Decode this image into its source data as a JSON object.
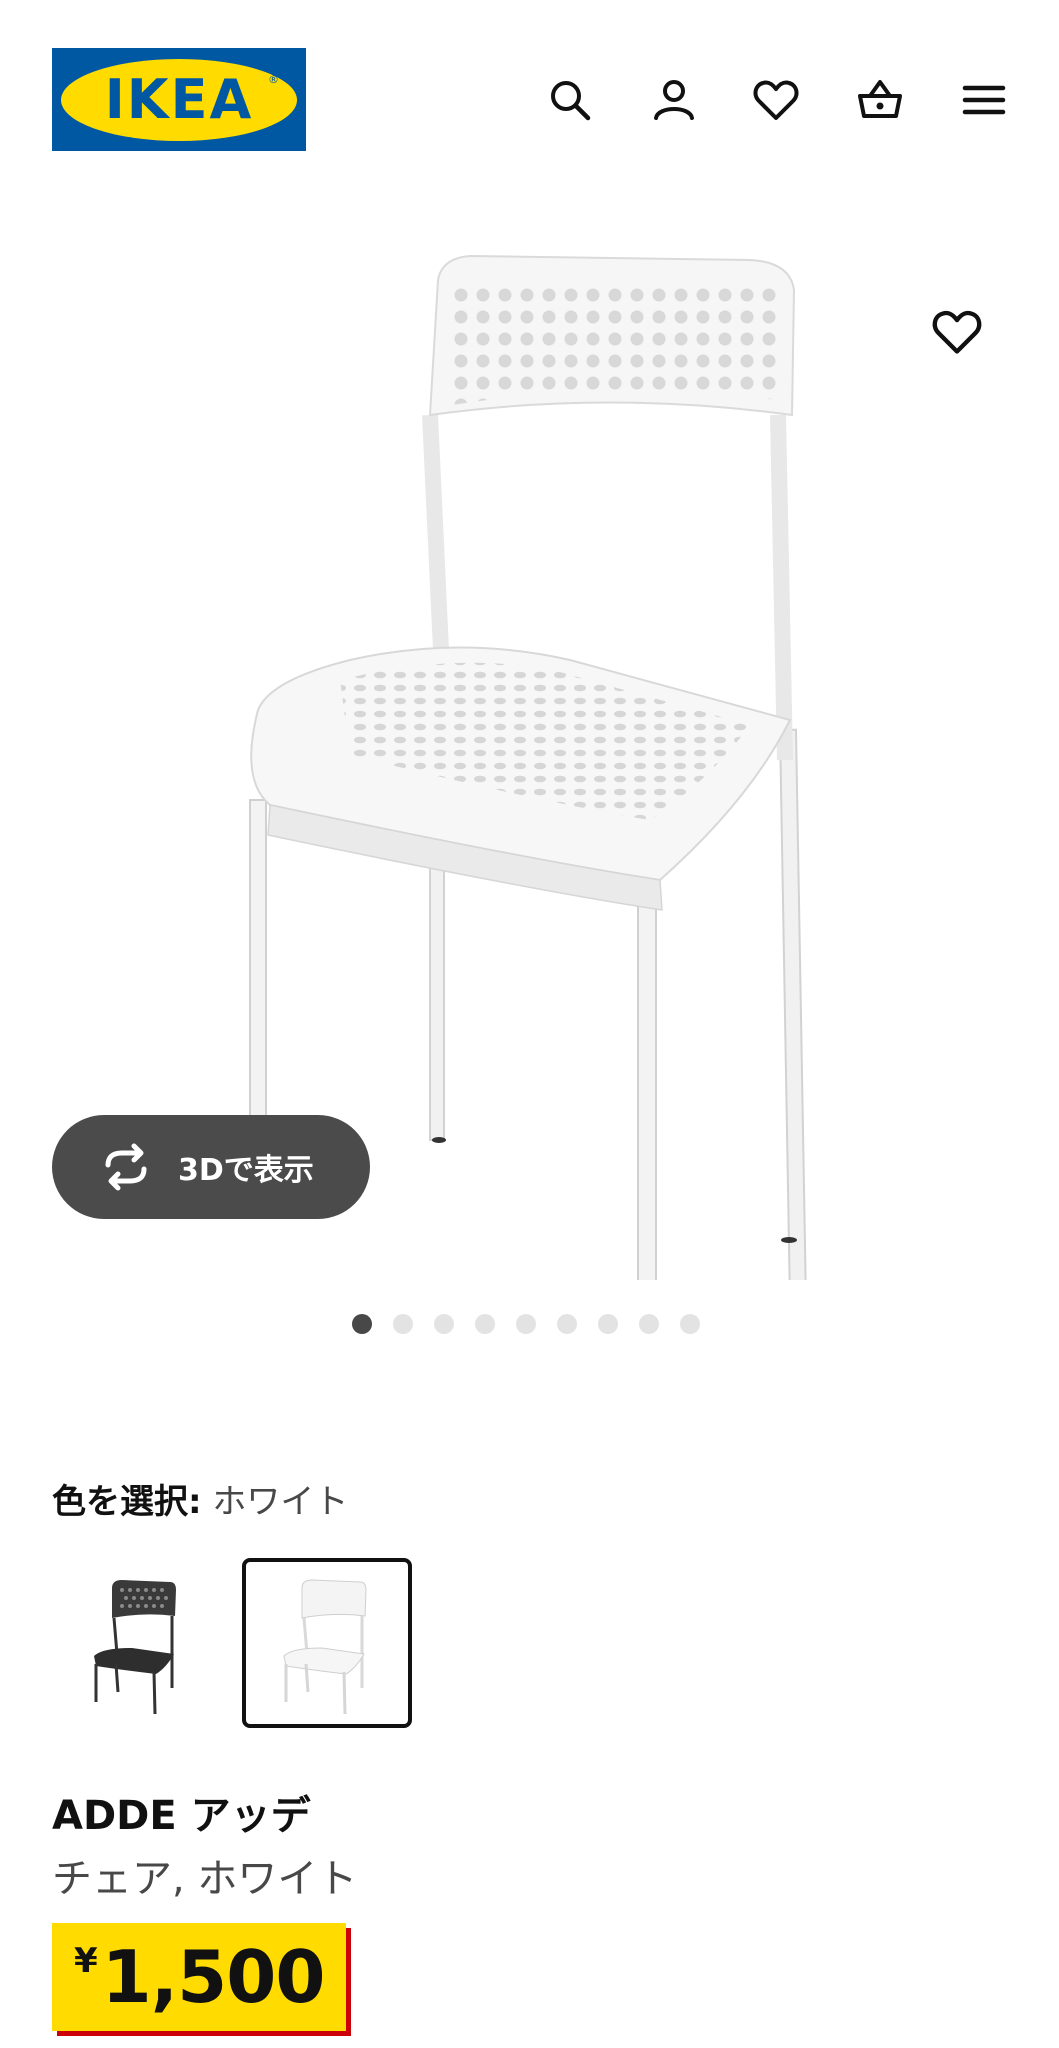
{
  "header": {
    "logo_text": "IKEA",
    "logo_reg": "®",
    "icons": [
      "search-icon",
      "account-icon",
      "heart-icon",
      "cart-icon",
      "menu-icon"
    ]
  },
  "media": {
    "view_3d_label": "3Dで表示",
    "image_count": 9,
    "active_image": 1
  },
  "color": {
    "label": "色を選択:",
    "value": "ホワイト",
    "options": [
      "black",
      "white"
    ],
    "selected": "white"
  },
  "product": {
    "name": "ADDE アッデ",
    "description": "チェア, ホワイト",
    "currency": "¥",
    "price": "1,500"
  },
  "colors": {
    "ikea_blue": "#0058a3",
    "ikea_yellow": "#ffdb00",
    "price_shadow": "#cc0008",
    "pill_bg": "#4b4b4b"
  }
}
